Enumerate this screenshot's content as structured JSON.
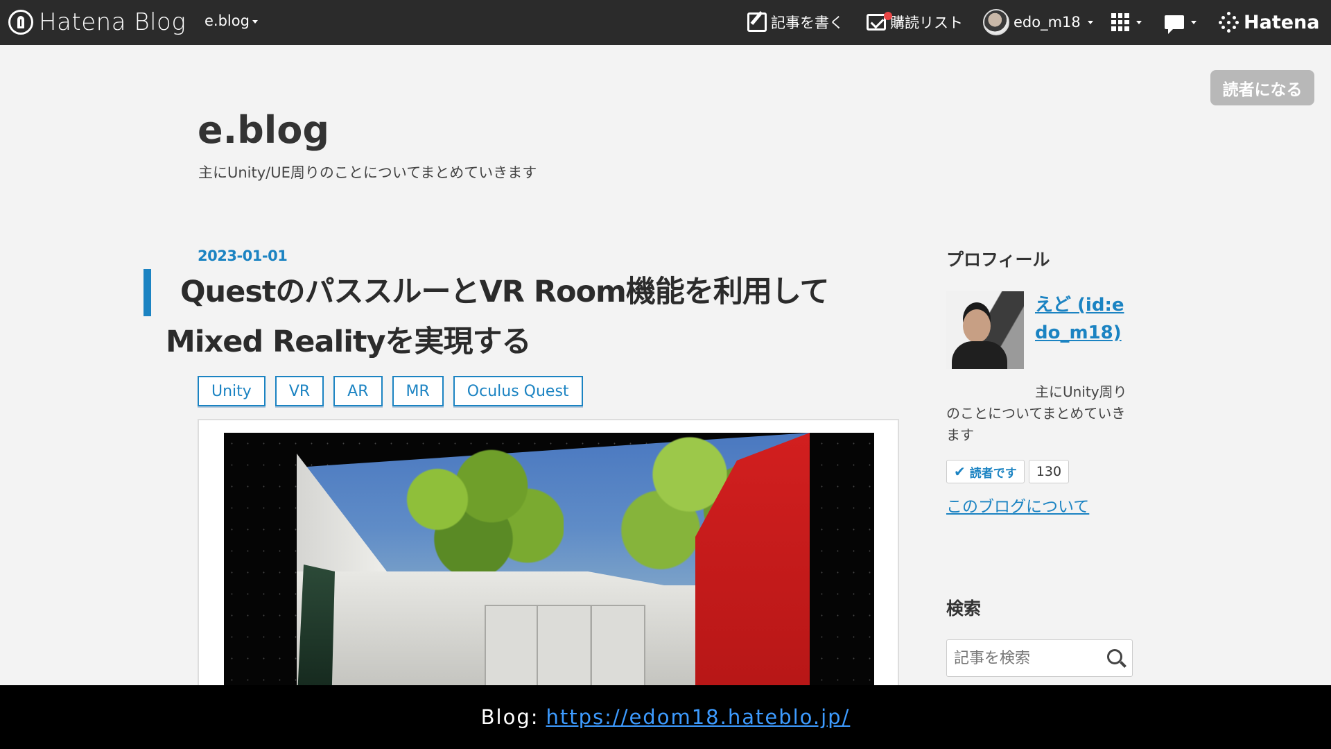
{
  "topbar": {
    "logo_text": "Hatena Blog",
    "blog_menu": "e.blog",
    "write_label": "記事を書く",
    "reading_list_label": "購読リスト",
    "username": "edo_m18",
    "hatena_label": "Hatena",
    "notification_color": "#e84545"
  },
  "subscribe_button": "読者になる",
  "header": {
    "title": "e.blog",
    "description": "主にUnity/UE周りのことについてまとめていきます"
  },
  "article": {
    "date": "2023-01-01",
    "title_line1": "QuestのパススルーとVR Room機能を利用して",
    "title_line2": "Mixed Realityを実現する",
    "tags": [
      "Unity",
      "VR",
      "AR",
      "MR",
      "Oculus Quest"
    ]
  },
  "sidebar": {
    "profile_heading": "プロフィール",
    "profile_name": "えど (id:edo_m18)",
    "profile_desc": "主にUnity周りのことについてまとめていきます",
    "follow_label": "読者です",
    "follow_count": "130",
    "about_link": "このブログについて",
    "search_heading": "検索",
    "search_placeholder": "記事を検索"
  },
  "caption": {
    "label": "Blog:",
    "url": "https://edom18.hateblo.jp/"
  },
  "colors": {
    "accent": "#1b83c2",
    "topbar": "#2b2b2b",
    "background": "#f3f3f3"
  }
}
